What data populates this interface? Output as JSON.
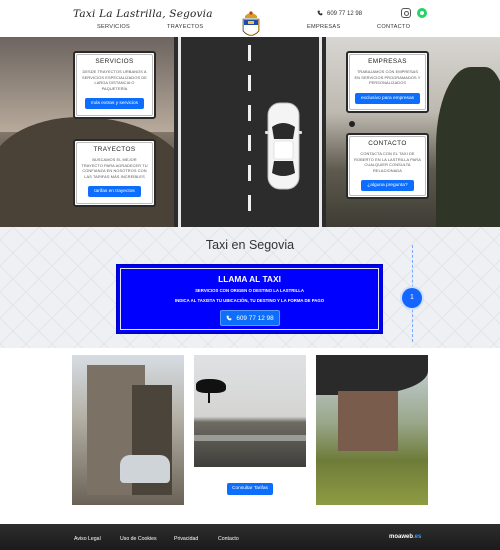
{
  "header": {
    "brand": "Taxi La Lastrilla, Segovia",
    "phone": "609 77 12 98",
    "nav": [
      {
        "label": "SERVICIOS"
      },
      {
        "label": "TRAYECTOS"
      },
      {
        "label": "EMPRESAS"
      },
      {
        "label": "CONTACTO"
      }
    ],
    "social": [
      "instagram-icon",
      "whatsapp-icon"
    ]
  },
  "hero": {
    "cards": {
      "servicios": {
        "title": "SERVICIOS",
        "text": "DESDE TRAYECTOS URBANOS A SERVICIOS ESPECIALIZADOS DE LARGA DISTANCIA O PAQUETERÍA",
        "button": "más extras y servicios"
      },
      "trayectos": {
        "title": "TRAYECTOS",
        "text": "BUSCAMOS EL MEJOR TRAYECTO PARA AGRADECER TU CONFIANZA EN NOSOTROS CON LAS TARIFAS MÁS INCREÍBLES",
        "button": "tarifas en trayectos"
      },
      "empresas": {
        "title": "EMPRESAS",
        "text": "TRABAJAMOS CON EMPRESAS EN SERVICIOS PROGRAMADOS Y PERSONALIZADOS",
        "button": "exclusivo para empresas"
      },
      "contacto": {
        "title": "CONTACTO",
        "text": "CONTACTA CON EL TAXI DE ROBERTO EN LA LASTRILLA PARA CUALQUIER CONSULTA RELACIONADA",
        "button": "¿alguna pregunta?"
      }
    }
  },
  "main": {
    "title": "Taxi en Segovia",
    "call": {
      "title": "LLAMA AL TAXI",
      "line1": "SERVICIOS CON ORIGEN O DESTINO LA LASTRILLA",
      "line2": "INDICA AL TAXISTA TU UBICACIÓN, TU DESTINO Y LA FORMA DE PAGO",
      "phone": "609 77 12 98"
    },
    "step": "1"
  },
  "gallery": {
    "button": "Consultar Tarifas"
  },
  "footer": {
    "links": [
      "Aviso Legal",
      "Uso de Cookies",
      "Privacidad",
      "Contacto"
    ],
    "brand_main": "moaweb",
    "brand_suffix": ".es"
  },
  "colors": {
    "accent": "#0d6efd",
    "call_box": "#0000ff",
    "footer": "#1b1b1b",
    "whatsapp": "#25d366"
  }
}
